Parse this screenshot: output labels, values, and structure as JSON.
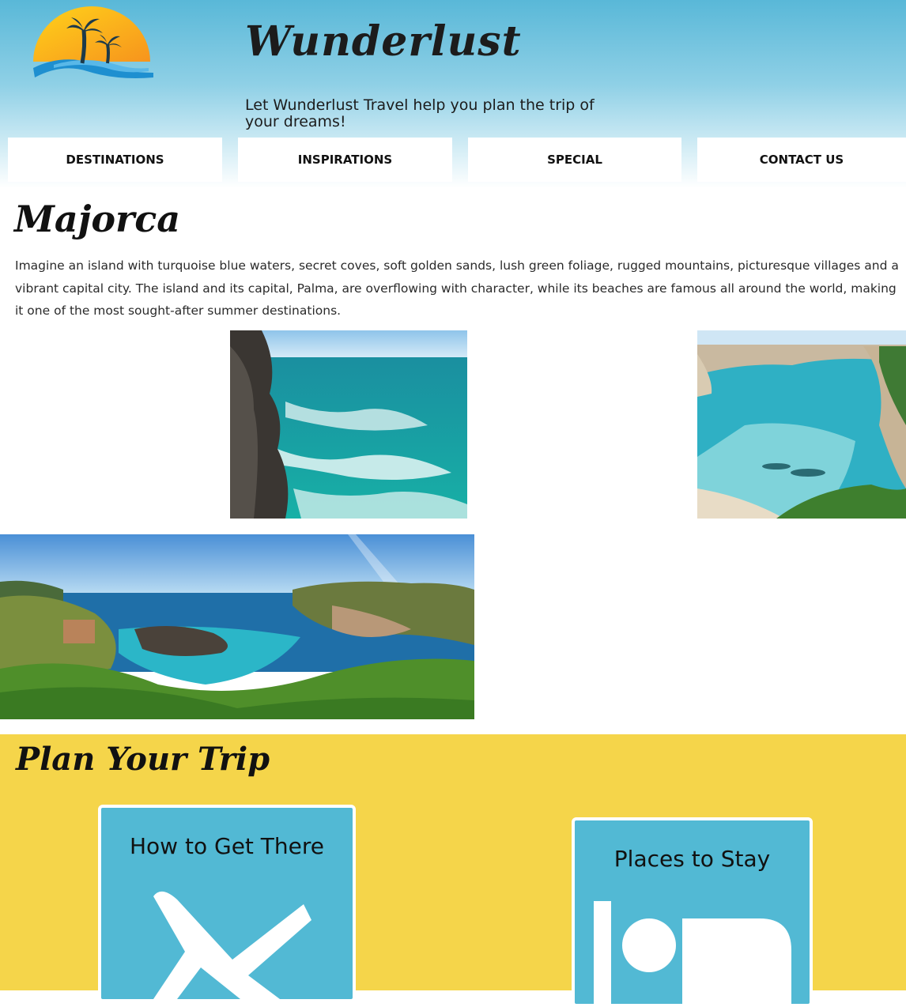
{
  "header": {
    "logo_icon": "palm-tree-sunset-logo",
    "title": "Wunderlust",
    "tagline": "Let Wunderlust Travel help you plan the trip of your dreams!"
  },
  "nav": {
    "items": [
      {
        "label": "DESTINATIONS"
      },
      {
        "label": "INSPIRATIONS"
      },
      {
        "label": "SPECIAL"
      },
      {
        "label": "CONTACT US"
      }
    ]
  },
  "main": {
    "heading": "Majorca",
    "intro": "Imagine an island with turquoise blue waters, secret coves, soft golden sands, lush green foliage, rugged mountains, picturesque villages and a vibrant capital city. The island and its capital, Palma, are overflowing with character, while its beaches are famous all around the world, making it one of the most sought-after summer destinations.",
    "photos": [
      "rocky-coast-waves-photo",
      "sandy-cove-photo",
      "cove-panorama-photo"
    ]
  },
  "plan": {
    "heading": "Plan Your Trip",
    "cards": [
      {
        "title": "How to Get There",
        "icon": "airplane-icon"
      },
      {
        "title": "Places to Stay",
        "icon": "bed-icon"
      }
    ]
  },
  "colors": {
    "header_blue": "#59b8d8",
    "card_blue": "#52b9d4",
    "plan_yellow": "#f5d54a"
  }
}
